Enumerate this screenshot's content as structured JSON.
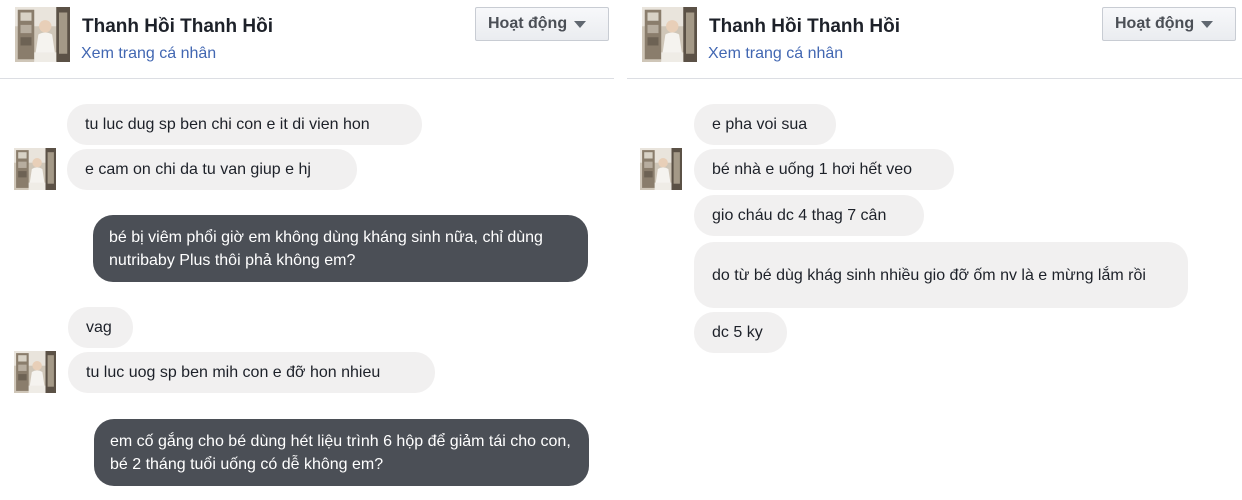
{
  "left": {
    "header": {
      "name": "Thanh Hồi Thanh Hồi",
      "profile_link": "Xem trang cá nhân",
      "status_label": "Hoạt động"
    },
    "messages": [
      {
        "from": "contact",
        "text": "tu luc dug sp ben chi con e it di vien hon"
      },
      {
        "from": "contact",
        "text": "e cam on chi da tu van giup e hj"
      },
      {
        "from": "me",
        "text": "bé bị viêm phổi giờ em không dùng kháng sinh nữa, chỉ dùng nutribaby Plus thôi phả không em?"
      },
      {
        "from": "contact",
        "text": "vag"
      },
      {
        "from": "contact",
        "text": "tu luc uog sp ben mih con e đỡ hon nhieu"
      },
      {
        "from": "me",
        "text": "em cố gắng cho bé dùng hét liệu trình 6 hộp để giảm tái cho con, bé  2 tháng tuổi uống có dễ không em?"
      }
    ]
  },
  "right": {
    "header": {
      "name": "Thanh Hồi Thanh Hồi",
      "profile_link": "Xem trang cá nhân",
      "status_label": "Hoạt động"
    },
    "messages": [
      {
        "from": "contact",
        "text": "e pha voi sua"
      },
      {
        "from": "contact",
        "text": "bé nhà e uống 1 hơi hết veo"
      },
      {
        "from": "contact",
        "text": "gio cháu dc 4 thag 7 cân"
      },
      {
        "from": "contact",
        "text": "do từ bé dùg khág sinh nhiều gio đỡ ốm nv là e mừng lắm rồi"
      },
      {
        "from": "contact",
        "text": "dc 5 ky"
      }
    ]
  },
  "colors": {
    "incoming_bubble": "#f1f0f0",
    "outgoing_bubble": "#4b4f56",
    "link": "#4267b2",
    "divider": "#dcdee3"
  },
  "icons": {
    "avatar": "contact-photo",
    "status_caret": "caret-down-icon"
  }
}
